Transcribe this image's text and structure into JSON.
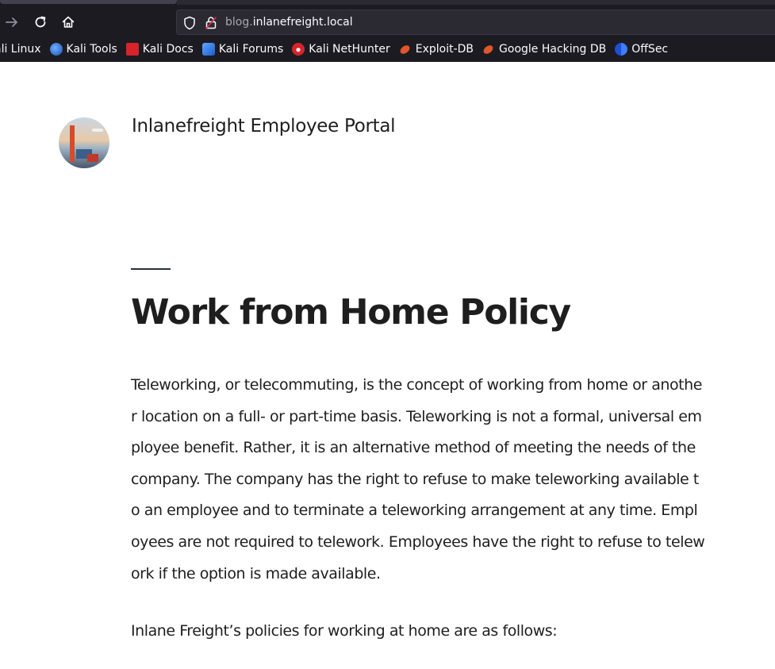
{
  "browser": {
    "url_subdomain": "blog.",
    "url_host": "inlanefreight.local",
    "bookmarks": [
      {
        "label": "ali Linux",
        "icon": "kali-icon"
      },
      {
        "label": "Kali Tools",
        "icon": "kali-tools-icon"
      },
      {
        "label": "Kali Docs",
        "icon": "kali-docs-icon"
      },
      {
        "label": "Kali Forums",
        "icon": "kali-forums-icon"
      },
      {
        "label": "Kali NetHunter",
        "icon": "nethunter-icon"
      },
      {
        "label": "Exploit-DB",
        "icon": "exploit-db-icon"
      },
      {
        "label": "Google Hacking DB",
        "icon": "ghdb-icon"
      },
      {
        "label": "OffSec",
        "icon": "offsec-icon"
      }
    ]
  },
  "site": {
    "title": "Inlanefreight Employee Portal"
  },
  "post": {
    "title": "Work from Home Policy",
    "paragraph1": "Teleworking, or telecommuting, is the concept of working from home or another location on a full- or part-time basis. Teleworking is not a formal, universal employee benefit. Rather, it is an alternative method of meeting the needs of the company. The company has the right to refuse to make teleworking available to an employee and to terminate a teleworking arrangement at any time. Employees are not required to telework. Employees have the right to refuse to telework if the option is made available.",
    "paragraph2": "Inlane Freight’s policies for working at home are as follows:"
  },
  "colors": {
    "chrome_bg": "#1c1b22",
    "url_bar_bg": "#2b2a33",
    "text": "#1e1e1e"
  }
}
